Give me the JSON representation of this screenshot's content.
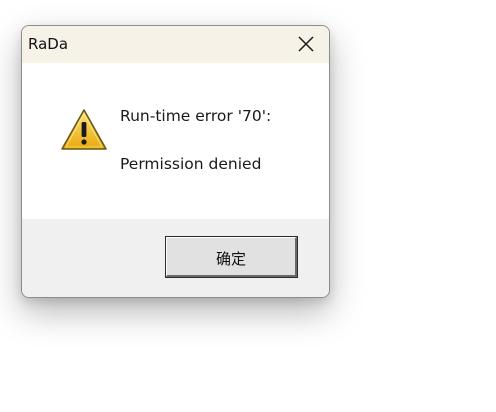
{
  "window": {
    "title": "RaDa",
    "close_icon": "close-icon"
  },
  "message": {
    "icon": "warning-icon",
    "line1": "Run-time error '70':",
    "line2": "Permission denied"
  },
  "buttons": {
    "ok_label": "确定"
  },
  "colors": {
    "titlebar": "#f6f2e8",
    "footer": "#f0f0f0",
    "warning_fill": "#f3c316",
    "warning_outline": "#6a5a10"
  }
}
